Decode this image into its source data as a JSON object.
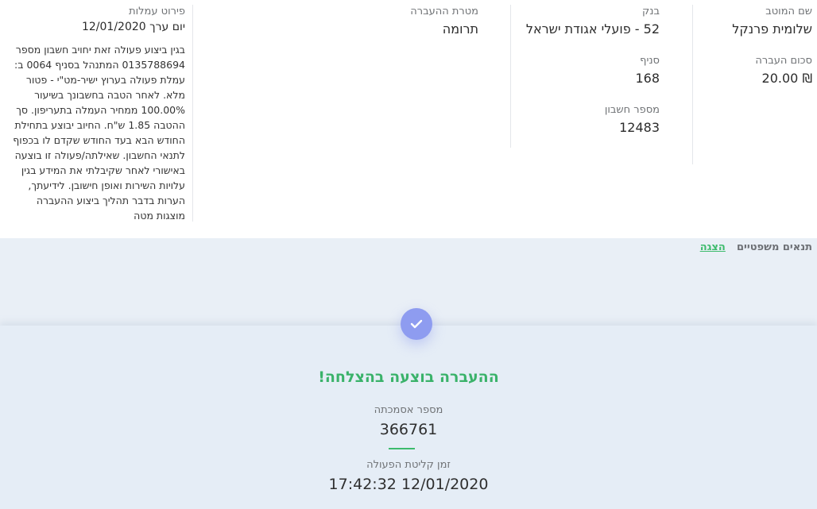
{
  "details": {
    "beneficiary_label": "שם המוטב",
    "beneficiary_value": "שלומית פרנקל",
    "amount_label": "סכום העברה",
    "amount_value": "₪ 20.00",
    "bank_label": "בנק",
    "bank_value": "52 - פועלי אגודת ישראל",
    "branch_label": "סניף",
    "branch_value": "168",
    "account_label": "מספר חשבון",
    "account_value": "12483",
    "purpose_label": "מטרת ההעברה",
    "purpose_value": "תרומה",
    "fees_label": "פירוט עמלות",
    "value_date": "יום ערך 12/01/2020",
    "fees_text": "בגין ביצוע פעולה זאת יחויב חשבון מספר 0135788694 המתנהל בסניף 0064 ב: עמלת פעולה בערוץ ישיר-מט\"י - פטור מלא. לאחר הטבה בחשבונך בשיעור 100.00% ממחיר העמלה בתעריפון. סך ההטבה 1.85 ש\"ח. החיוב יבוצע בתחילת החודש הבא בעד החודש שקדם לו בכפוף לתנאי החשבון. שאילתה/פעולה זו בוצעה באישורי לאחר שקיבלתי את המידע בגין עלויות השירות ואופן חישובן. לידיעתך, הערות בדבר תהליך ביצוע ההעברה מוצגות מטה"
  },
  "legal": {
    "title": "תנאים משפטיים",
    "link": "הצגה"
  },
  "result": {
    "success": "ההעברה בוצעה בהצלחה!",
    "ref_label": "מספר אסמכתה",
    "ref_value": "366761",
    "time_label": "זמן קליטת הפעולה",
    "time_value": "12/01/2020 17:42:32"
  },
  "colors": {
    "success_green": "#3ab26a",
    "check_circle": "#8e9cf0",
    "bottom_bg": "#e9eff6"
  },
  "icons": {
    "success": "check-icon"
  }
}
